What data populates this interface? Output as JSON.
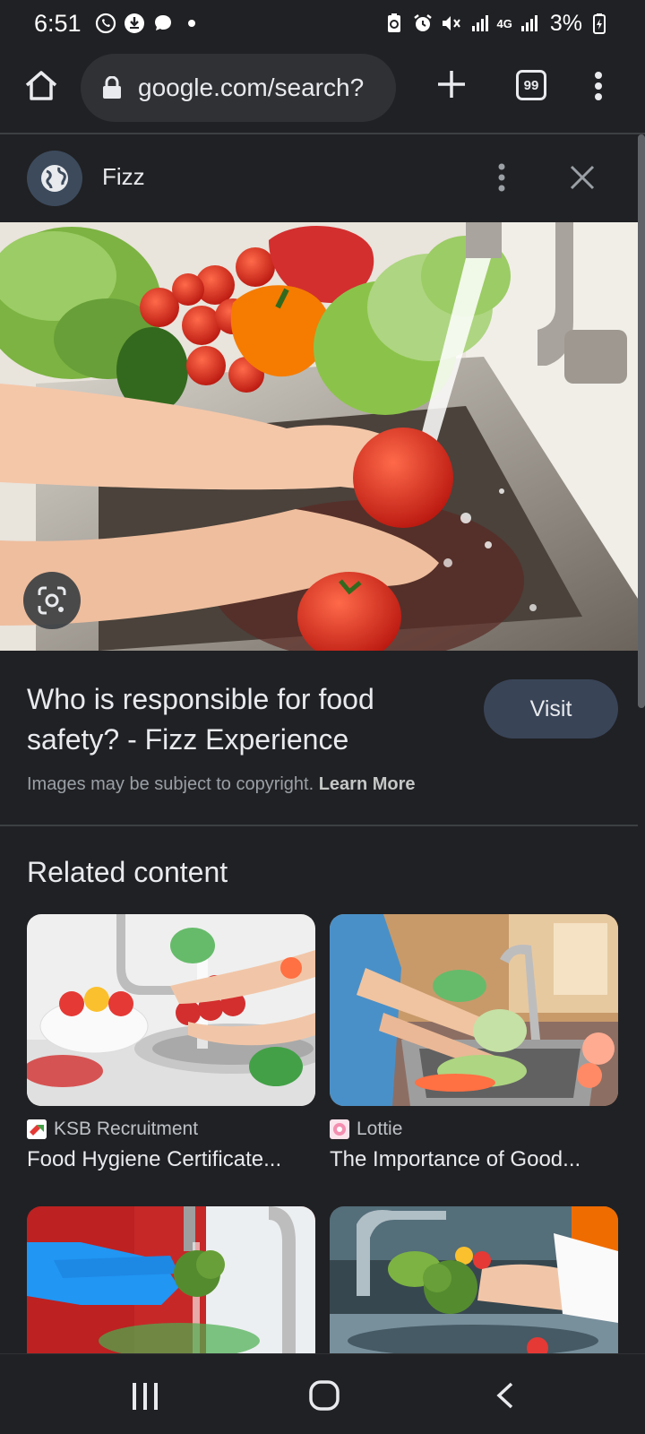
{
  "status_bar": {
    "time": "6:51",
    "battery": "3%",
    "network": "4G",
    "icons": [
      "whatsapp-icon",
      "download-icon",
      "chat-icon",
      "dot-icon",
      "battery-saver-icon",
      "alarm-icon",
      "mute-icon",
      "signal-icon",
      "signal-icon",
      "battery-icon"
    ]
  },
  "browser": {
    "url": "google.com/search?",
    "tab_count": "99"
  },
  "panel": {
    "site_name": "Fizz",
    "result_title": "Who is responsible for food safety? - Fizz Experience",
    "visit_label": "Visit",
    "copyright_text": "Images may be subject to copyright.",
    "learn_more": "Learn More"
  },
  "related": {
    "heading": "Related content",
    "cards": [
      {
        "source": "KSB Recruitment",
        "title": "Food Hygiene Certificate...",
        "favicon_color": "#e53935"
      },
      {
        "source": "Lottie",
        "title": "The Importance of Good...",
        "favicon_color": "#f48fb1"
      }
    ]
  },
  "colors": {
    "background": "#202124",
    "surface": "#303134",
    "visit_button": "#394457",
    "text": "#e8eaed",
    "muted_text": "#9aa0a6"
  }
}
